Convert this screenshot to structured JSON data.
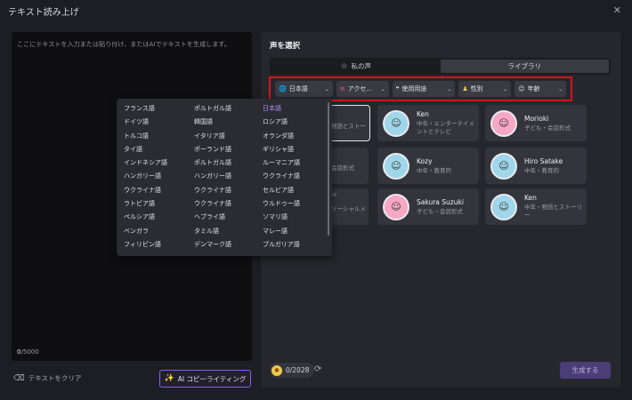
{
  "window": {
    "title": "テキスト読み上げ",
    "close": "✕"
  },
  "editor": {
    "placeholder": "ここにテキストを入力または貼り付け、またはAIでテキストを生成します。",
    "count_current": "0",
    "count_max": "/5000"
  },
  "footer_left": {
    "clear_label": "テキストをクリア",
    "ai_label": "AI コピーライティング"
  },
  "panel": {
    "heading": "声を選択",
    "tabs": [
      {
        "label": "私の声"
      },
      {
        "label": "ライブラリ"
      }
    ],
    "filters": [
      {
        "label": "日本語"
      },
      {
        "label": "アクセ..."
      },
      {
        "label": "使用用途"
      },
      {
        "label": "性別"
      },
      {
        "label": "年齢"
      }
    ],
    "partials": [
      "物語とストー",
      "会話形式",
      "ni",
      "ソーシャルメ"
    ],
    "cards": [
      {
        "name": "Ken",
        "desc": "中年・エンターテイメントとテレビ"
      },
      {
        "name": "Morioki",
        "desc": "子ども・会話形式"
      },
      {
        "name": "Kozy",
        "desc": "中年・教育的"
      },
      {
        "name": "Hiro Satake",
        "desc": "中年・教育的"
      },
      {
        "name": "Sakura Suzuki",
        "desc": "子ども・会話形式"
      },
      {
        "name": "Ken",
        "desc": "中年・物語とストーリー"
      }
    ],
    "credits": "0/2028",
    "generate_label": "生成する"
  },
  "languages": {
    "col1": [
      "フランス語",
      "ドイツ語",
      "トルコ語",
      "タイ語",
      "インドネシア語",
      "ハンガリー語",
      "ウクライナ語",
      "ラトビア語",
      "ペルシア語",
      "ベンガラ",
      "フィリピン語"
    ],
    "col2": [
      "ポルトガル語",
      "韓国語",
      "イタリア語",
      "ポーランド語",
      "ポルトガル語",
      "ハンガリー語",
      "ウクライナ語",
      "ウクライナ語",
      "ヘブライ語",
      "タミル語",
      "デンマーク語"
    ],
    "col3": [
      "日本語",
      "ロシア語",
      "オランダ語",
      "ギリシャ語",
      "ルーマニア語",
      "ウクライナ語",
      "セルビア語",
      "ウルドゥー語",
      "ソマリ語",
      "マレー語",
      "ブルガリア語"
    ]
  },
  "colors": {
    "accent": "#8a5cf6",
    "highlight": "#d3131c",
    "selected_language": "#b68bff"
  }
}
